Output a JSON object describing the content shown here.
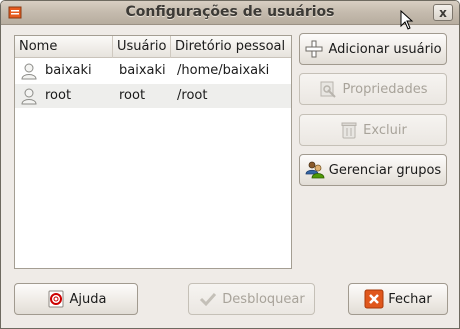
{
  "window": {
    "title": "Configurações de usuários",
    "close_label": "x"
  },
  "list": {
    "columns": [
      "Nome",
      "Usuário",
      "Diretório pessoal"
    ],
    "rows": [
      {
        "name": "baixaki",
        "user": "baixaki",
        "home": "/home/baixaki"
      },
      {
        "name": "root",
        "user": "root",
        "home": "/root"
      }
    ]
  },
  "side_buttons": {
    "add": {
      "label": "Adicionar usuário",
      "icon": "plus-icon"
    },
    "properties": {
      "label": "Propriedades",
      "icon": "properties-icon",
      "enabled": false
    },
    "delete": {
      "label": "Excluir",
      "icon": "trash-icon",
      "enabled": false
    },
    "groups": {
      "label": "Gerenciar grupos",
      "icon": "users-group-icon"
    }
  },
  "footer_buttons": {
    "help": {
      "label": "Ajuda",
      "icon": "help-icon"
    },
    "unlock": {
      "label": "Desbloquear",
      "icon": "check-icon",
      "enabled": false
    },
    "close": {
      "label": "Fechar",
      "icon": "close-x-icon"
    }
  }
}
